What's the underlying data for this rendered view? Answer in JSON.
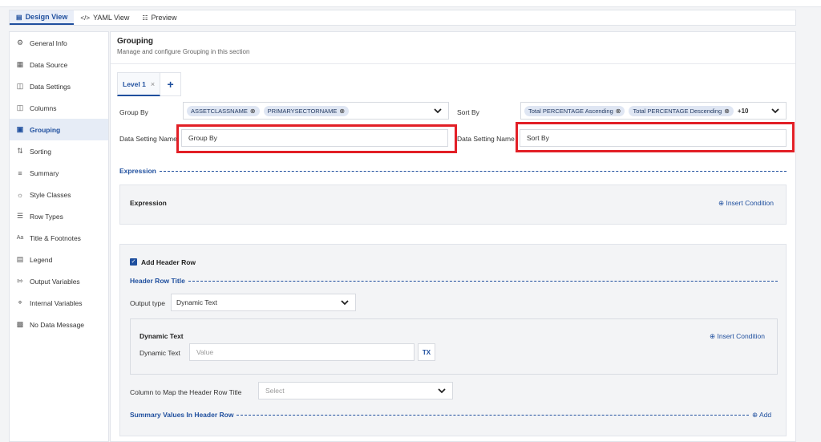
{
  "view_tabs": [
    {
      "label": "Design View",
      "icon": "document-icon"
    },
    {
      "label": "YAML View",
      "icon": "code-icon"
    },
    {
      "label": "Preview",
      "icon": "preview-icon"
    }
  ],
  "sidebar": {
    "items": [
      {
        "label": "General Info",
        "icon": "gear-icon"
      },
      {
        "label": "Data Source",
        "icon": "database-icon"
      },
      {
        "label": "Data Settings",
        "icon": "settings-icon"
      },
      {
        "label": "Columns",
        "icon": "columns-icon"
      },
      {
        "label": "Grouping",
        "icon": "grouping-icon"
      },
      {
        "label": "Sorting",
        "icon": "sort-icon"
      },
      {
        "label": "Summary",
        "icon": "summary-icon"
      },
      {
        "label": "Style Classes",
        "icon": "palette-icon"
      },
      {
        "label": "Row Types",
        "icon": "row-types-icon"
      },
      {
        "label": "Title & Footnotes",
        "icon": "text-icon"
      },
      {
        "label": "Legend",
        "icon": "legend-icon"
      },
      {
        "label": "Output Variables",
        "icon": "output-icon"
      },
      {
        "label": "Internal Variables",
        "icon": "variables-icon"
      },
      {
        "label": "No Data Message",
        "icon": "message-icon"
      }
    ],
    "active_index": 4
  },
  "section": {
    "title": "Grouping",
    "subtitle": "Manage and configure Grouping in this section"
  },
  "level_tabs": [
    {
      "label": "Level 1"
    }
  ],
  "group_by": {
    "label": "Group By",
    "chips": [
      "ASSETCLASSNAME",
      "PRIMARYSECTORNAME"
    ]
  },
  "sort_by": {
    "label": "Sort By",
    "chips": [
      "Total PERCENTAGE Ascending",
      "Total PERCENTAGE Descending"
    ],
    "more": "+10"
  },
  "group_setting": {
    "label": "Data Setting Name",
    "value": "Group By"
  },
  "sort_setting": {
    "label": "Data Setting Name",
    "value": "Sort By"
  },
  "expression": {
    "divider": "Expression",
    "panel_title": "Expression",
    "insert_condition": "Insert Condition"
  },
  "header_row": {
    "checkbox_label": "Add Header Row",
    "checked": true,
    "title_divider": "Header Row Title",
    "output_type_label": "Output type",
    "output_type_value": "Dynamic Text",
    "dynamic": {
      "title": "Dynamic Text",
      "insert_condition": "Insert Condition",
      "field_label": "Dynamic Text",
      "placeholder": "Value",
      "tx_label": "TX"
    },
    "column_map_label": "Column to Map the Header Row Title",
    "column_map_placeholder": "Select",
    "summary_divider": "Summary Values In Header Row",
    "add_label": "Add"
  },
  "colors": {
    "accent": "#1f4f9e",
    "highlight_red": "#e21f26",
    "chip_bg": "#dfe6f3"
  }
}
